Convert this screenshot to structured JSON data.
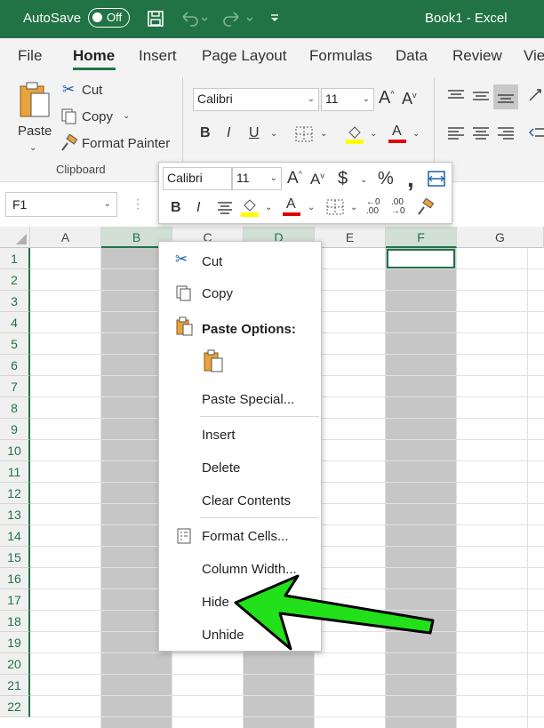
{
  "titlebar": {
    "autosave_label": "AutoSave",
    "autosave_state": "Off",
    "title": "Book1  -  Excel"
  },
  "tabs": [
    "File",
    "Home",
    "Insert",
    "Page Layout",
    "Formulas",
    "Data",
    "Review",
    "Vie"
  ],
  "active_tab": "Home",
  "ribbon": {
    "paste_label": "Paste",
    "cut_label": "Cut",
    "copy_label": "Copy",
    "format_painter_label": "Format Painter",
    "clipboard_group": "Clipboard",
    "font_name": "Calibri",
    "font_size": "11"
  },
  "mini_toolbar": {
    "font_name": "Calibri",
    "font_size": "11"
  },
  "namebox": {
    "value": "F1"
  },
  "columns": [
    "A",
    "B",
    "C",
    "D",
    "E",
    "F",
    "G"
  ],
  "selected_columns": [
    "B",
    "D",
    "F"
  ],
  "rows": [
    "1",
    "2",
    "3",
    "4",
    "5",
    "6",
    "7",
    "8",
    "9",
    "10",
    "11",
    "12",
    "13",
    "14",
    "15",
    "16",
    "17",
    "18",
    "19",
    "20",
    "21",
    "22"
  ],
  "context_menu": {
    "cut": "Cut",
    "copy": "Copy",
    "paste_options": "Paste Options:",
    "paste_special": "Paste Special...",
    "insert": "Insert",
    "delete": "Delete",
    "clear_contents": "Clear Contents",
    "format_cells": "Format Cells...",
    "column_width": "Column Width...",
    "hide": "Hide",
    "unhide": "Unhide"
  },
  "colors": {
    "excel_green": "#217346",
    "arrow_green": "#22e01a",
    "highlight_yellow": "#ffff00",
    "font_red": "#e00000"
  }
}
